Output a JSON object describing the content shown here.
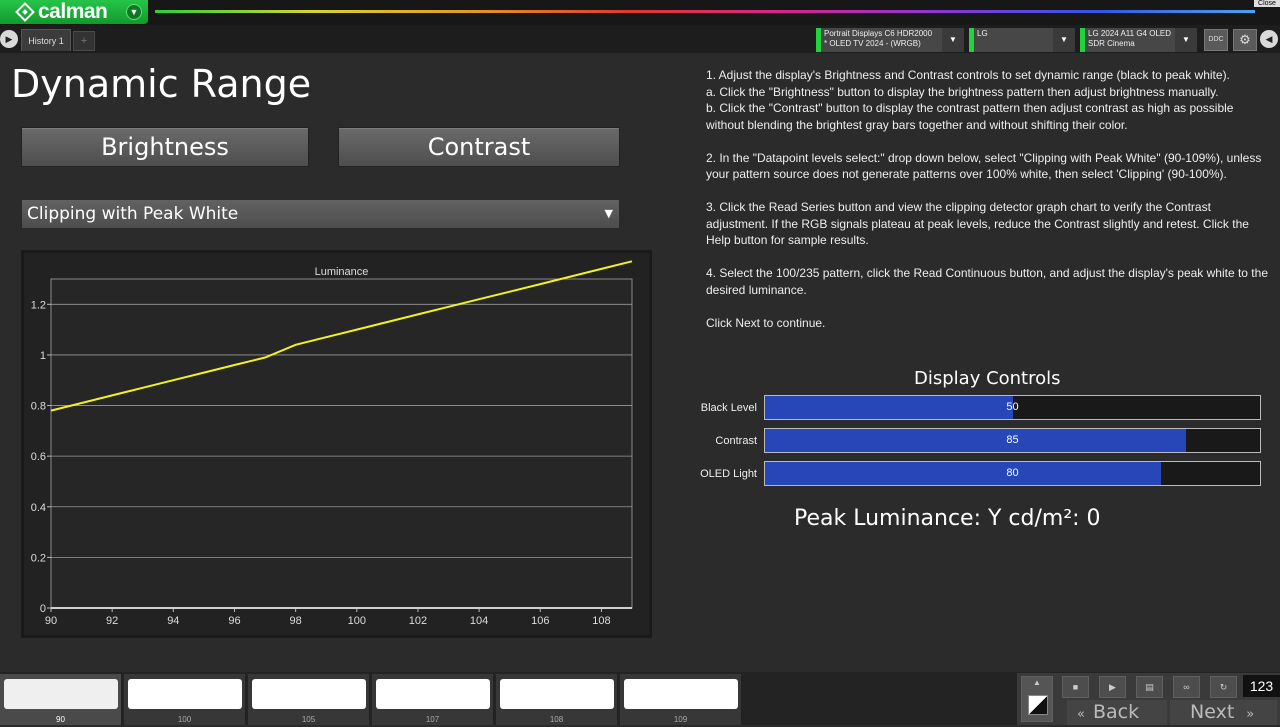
{
  "app": {
    "logo_text": "calman",
    "close_label": "Close"
  },
  "tabs": {
    "history": "History 1",
    "add": "+"
  },
  "devices": [
    {
      "line1": "Portrait Displays C6 HDR2000",
      "line2": "* OLED TV 2024 - (WRGB)"
    },
    {
      "line1": "LG",
      "line2": ""
    },
    {
      "line1": "LG 2024 A11 G4 OLED",
      "line2": "SDR Cinema"
    }
  ],
  "toolbar": {
    "ddc_label": "DDC"
  },
  "page": {
    "title": "Dynamic Range",
    "brightness_button": "Brightness",
    "contrast_button": "Contrast",
    "datapoint_select": "Clipping with Peak White"
  },
  "instructions": [
    "1. Adjust the display's Brightness and Contrast controls to set dynamic range (black to peak white).\na. Click the \"Brightness\" button to display the brightness pattern then adjust brightness manually.\nb. Click the \"Contrast\" button to display the contrast pattern then adjust contrast as high as possible without blending the brightest gray bars together and without shifting their color.",
    "2. In the \"Datapoint levels select:\" drop down below, select \"Clipping with Peak White\" (90-109%), unless your pattern source does not generate patterns over 100% white, then select 'Clipping' (90-100%).",
    "3. Click the Read Series button and view the clipping detector graph chart to verify the Contrast adjustment. If the RGB signals plateau at peak levels, reduce the Contrast slightly and retest. Click the Help button for sample results.",
    "4. Select the 100/235 pattern, click the Read Continuous button, and adjust the display's peak white to the desired luminance.",
    "Click Next to continue."
  ],
  "display_controls": {
    "title": "Display Controls",
    "items": [
      {
        "label": "Black Level",
        "value": 50,
        "fraction": 0.5
      },
      {
        "label": "Contrast",
        "value": 85,
        "fraction": 0.85
      },
      {
        "label": "OLED Light",
        "value": 80,
        "fraction": 0.8
      }
    ]
  },
  "peak_luminance": "Peak Luminance:  Y cd/m²: 0",
  "chart_data": {
    "type": "line",
    "title": "Luminance",
    "x_ticks": [
      "90",
      "92",
      "94",
      "96",
      "98",
      "100",
      "102",
      "104",
      "106",
      "108"
    ],
    "y_ticks": [
      "0",
      "0.2",
      "0.4",
      "0.6",
      "0.8",
      "1",
      "1.2"
    ],
    "xlim": [
      90,
      109
    ],
    "ylim": [
      0,
      1.3
    ],
    "grid": true,
    "series": [
      {
        "color": "#f2f21e",
        "x": [
          90,
          91,
          92,
          93,
          94,
          95,
          96,
          97,
          98,
          99,
          100,
          101,
          102,
          103,
          104,
          105,
          106,
          107,
          108,
          109
        ],
        "y": [
          0.78,
          0.81,
          0.84,
          0.87,
          0.9,
          0.93,
          0.96,
          0.99,
          1.04,
          1.07,
          1.1,
          1.13,
          1.16,
          1.19,
          1.22,
          1.25,
          1.28,
          1.31,
          1.34,
          1.37
        ]
      }
    ]
  },
  "patterns": {
    "items": [
      {
        "label": "90",
        "active": true
      },
      {
        "label": "100",
        "active": false
      },
      {
        "label": "105",
        "active": false
      },
      {
        "label": "107",
        "active": false
      },
      {
        "label": "108",
        "active": false
      },
      {
        "label": "109",
        "active": false
      }
    ]
  },
  "navigation": {
    "back_label": "Back",
    "next_label": "Next",
    "counter": "123"
  }
}
